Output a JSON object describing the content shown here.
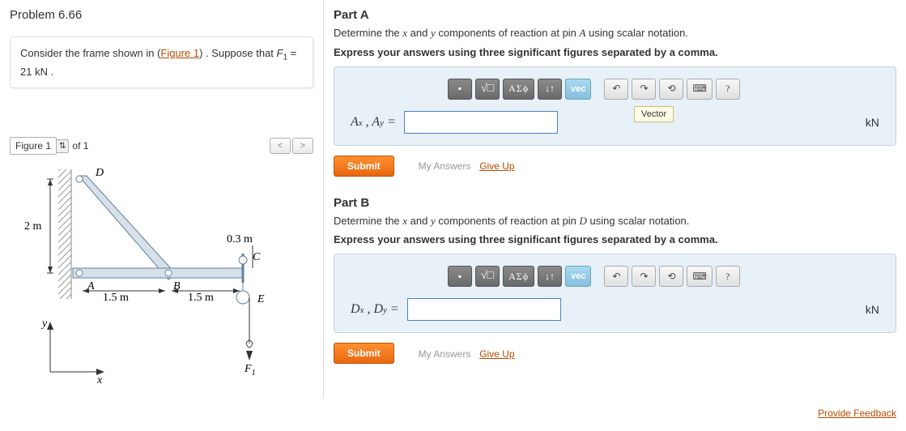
{
  "problem": {
    "title": "Problem 6.66",
    "prompt_pre": "Consider the frame shown in (",
    "prompt_link": "Figure 1",
    "prompt_post": ") . Suppose that ",
    "var": "F",
    "var_sub": "1",
    "equals": " = 21  kN ."
  },
  "figure": {
    "tab": "Figure 1",
    "of": "of 1",
    "dims": {
      "D": "D",
      "A": "A",
      "B": "B",
      "C": "C",
      "E": "E",
      "F1": "F",
      "F1sub": "1",
      "h": "2 m",
      "w1": "1.5 m",
      "w2": "1.5 m",
      "h2": "0.3 m",
      "x": "x",
      "y": "y"
    }
  },
  "partA": {
    "title": "Part A",
    "text_pre": "Determine the ",
    "x": "x",
    "and": " and ",
    "y": "y",
    "text_mid": " components of reaction at pin ",
    "pin": "A",
    "text_post": " using scalar notation.",
    "bold": "Express your answers using three significant figures separated by a comma.",
    "labelA": "A",
    "labelAsub": "x",
    "labelB": "A",
    "labelBsub": "y",
    "eq": " = ",
    "unit": "kN",
    "submit": "Submit",
    "myans": "My Answers",
    "giveup": "Give Up",
    "tooltip": "Vector",
    "tb": {
      "greek": "ΑΣϕ",
      "vec": "vec",
      "help": "?"
    }
  },
  "partB": {
    "title": "Part B",
    "text_pre": "Determine the ",
    "x": "x",
    "and": " and ",
    "y": "y",
    "text_mid": " components of reaction at pin ",
    "pin": "D",
    "text_post": " using scalar notation.",
    "bold": "Express your answers using three significant figures separated by a comma.",
    "labelA": "D",
    "labelAsub": "x",
    "labelB": "D",
    "labelBsub": "y",
    "eq": " = ",
    "unit": "kN",
    "submit": "Submit",
    "myans": "My Answers",
    "giveup": "Give Up",
    "tb": {
      "greek": "ΑΣϕ",
      "vec": "vec",
      "help": "?"
    }
  },
  "feedback": "Provide Feedback"
}
